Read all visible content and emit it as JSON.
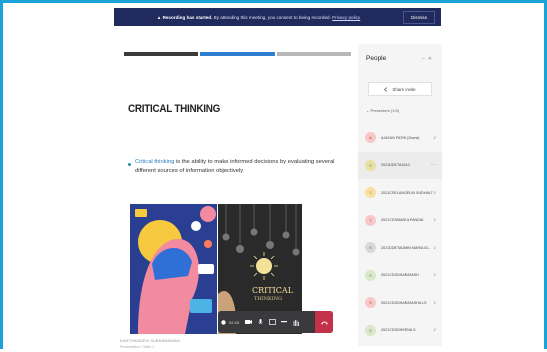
{
  "banner": {
    "bold": "Recording has started.",
    "message": " By attending this meeting, you consent to being recorded.",
    "link": "Privacy policy",
    "dismiss": "Dismiss"
  },
  "slide": {
    "title": "CRITICAL THINKING",
    "bullet_keyword": "Critical thinking",
    "bullet_text": " is the ability to make informed decisions by evaluating several different sources of information objectively",
    "image_right_text_1": "CRITICAL",
    "image_right_text_2": "THINKING",
    "caption_1": "KARTHIKADEVI SUBRAMANIAN",
    "caption_2": "Presentation / Slide 1"
  },
  "toolbar": {
    "time": "02:43"
  },
  "people": {
    "title": "People",
    "share_label": "Share invite",
    "section_label": "Presenters (1/9)",
    "participants": [
      {
        "initial": "A",
        "name": "AJAYAN PATHI (Guest)",
        "color": "#f8c8c8",
        "fg": "#a44"
      },
      {
        "initial": "S",
        "name": "2021DDETA1610",
        "color": "#e6e2a3",
        "fg": "#776"
      },
      {
        "initial": "S",
        "name": "2021CSELANGELIN SUDHALT",
        "color": "#f7e0a0",
        "fg": "#a86"
      },
      {
        "initial": "T",
        "name": "2021CDSMARULPANDIA",
        "color": "#f8c8c8",
        "fg": "#a44"
      },
      {
        "initial": "S",
        "name": "2021DDETADMIN MARIA ID...",
        "color": "#d9d9d9",
        "fg": "#666"
      },
      {
        "initial": "S",
        "name": "2021CDSDHARANISH",
        "color": "#d8e8c8",
        "fg": "#686"
      },
      {
        "initial": "S",
        "name": "2021CDSDHARANISHA LS",
        "color": "#f8c8c8",
        "fg": "#a44"
      },
      {
        "initial": "S",
        "name": "2021CDSDHEENA S",
        "color": "#d8e8c8",
        "fg": "#686"
      }
    ]
  },
  "colors": {
    "frame": "#1aa3d6",
    "banner": "#202a5c",
    "leave": "#c4314b"
  }
}
